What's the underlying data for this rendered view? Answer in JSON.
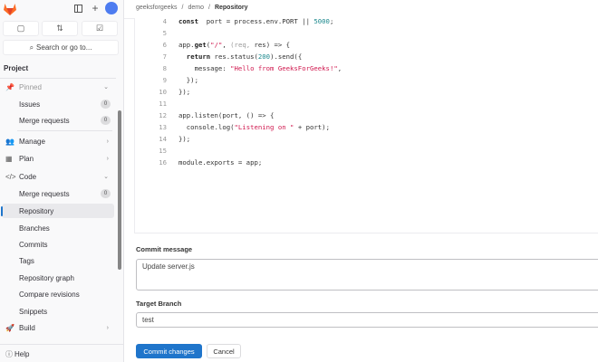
{
  "sidebar": {
    "search_placeholder": "Search or go to...",
    "section": "Project",
    "pinned": "Pinned",
    "items": [
      {
        "label": "Issues",
        "badge": "0"
      },
      {
        "label": "Merge requests",
        "badge": "0"
      },
      {
        "label": "Manage"
      },
      {
        "label": "Plan"
      },
      {
        "label": "Code"
      },
      {
        "label": "Merge requests",
        "badge": "0"
      },
      {
        "label": "Repository"
      },
      {
        "label": "Branches"
      },
      {
        "label": "Commits"
      },
      {
        "label": "Tags"
      },
      {
        "label": "Repository graph"
      },
      {
        "label": "Compare revisions"
      },
      {
        "label": "Snippets"
      },
      {
        "label": "Build"
      }
    ],
    "help": "Help"
  },
  "breadcrumb": [
    "geeksforgeeks",
    "demo",
    "Repository"
  ],
  "code": [
    {
      "n": "4",
      "tokens": [
        [
          "k",
          "const"
        ],
        [
          "",
          "  port = process.env.PORT || "
        ],
        [
          "n",
          "5000"
        ],
        [
          "",
          ";"
        ]
      ]
    },
    {
      "n": "5",
      "tokens": []
    },
    {
      "n": "6",
      "tokens": [
        [
          "",
          "app."
        ],
        [
          "k",
          "get"
        ],
        [
          "",
          "("
        ],
        [
          "s",
          "\"/\""
        ],
        [
          "",
          ", "
        ],
        [
          "p",
          "(req, "
        ],
        [
          "",
          "res) => {"
        ]
      ]
    },
    {
      "n": "7",
      "tokens": [
        [
          "",
          "  "
        ],
        [
          "k",
          "return"
        ],
        [
          "",
          " res.status("
        ],
        [
          "n",
          "200"
        ],
        [
          "",
          ").send({"
        ]
      ]
    },
    {
      "n": "8",
      "tokens": [
        [
          "",
          "    message: "
        ],
        [
          "s",
          "\"Hello from GeeksForGeeks!\""
        ],
        [
          "",
          ","
        ]
      ]
    },
    {
      "n": "9",
      "tokens": [
        [
          "",
          "  });"
        ]
      ]
    },
    {
      "n": "10",
      "tokens": [
        [
          "",
          "});"
        ]
      ]
    },
    {
      "n": "11",
      "tokens": []
    },
    {
      "n": "12",
      "tokens": [
        [
          "",
          "app.listen(port, () => {"
        ]
      ]
    },
    {
      "n": "13",
      "tokens": [
        [
          "",
          "  console.log("
        ],
        [
          "s",
          "\"Listening on \""
        ],
        [
          "",
          " + port);"
        ]
      ]
    },
    {
      "n": "14",
      "tokens": [
        [
          "",
          "});"
        ]
      ]
    },
    {
      "n": "15",
      "tokens": []
    },
    {
      "n": "16",
      "tokens": [
        [
          "",
          "module.exports = app;"
        ]
      ]
    }
  ],
  "form": {
    "commit_label": "Commit message",
    "commit_value": "Update server.js",
    "branch_label": "Target Branch",
    "branch_value": "test",
    "commit_button": "Commit changes",
    "cancel_button": "Cancel"
  }
}
